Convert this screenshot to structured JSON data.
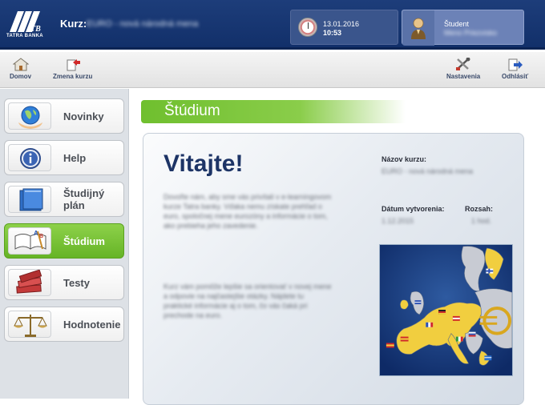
{
  "header": {
    "logo_text": "TATRA BANKA",
    "logo_initials": "TB",
    "course_label": "Kurz:",
    "course_name": "EURO - nová národná mena",
    "date": "13.01.2016",
    "time": "10:53",
    "user_role": "Študent",
    "user_name": "Meno Priezvisko"
  },
  "toolbar": {
    "home_label": "Domov",
    "change_course_label": "Zmena kurzu",
    "settings_label": "Nastavenia",
    "logout_label": "Odhlásiť"
  },
  "sidebar": {
    "items": [
      {
        "label": "Novinky",
        "icon": "globe-icon"
      },
      {
        "label": "Help",
        "icon": "info-icon"
      },
      {
        "label": "Študijný plán",
        "label_line1": "Študijný",
        "label_line2": "plán",
        "icon": "folder-icon"
      },
      {
        "label": "Štúdium",
        "icon": "book-icon",
        "active": true
      },
      {
        "label": "Testy",
        "icon": "books-icon"
      },
      {
        "label": "Hodnotenie",
        "icon": "scales-icon"
      }
    ]
  },
  "main": {
    "section_title": "Štúdium",
    "welcome": "Vitajte!",
    "paragraph1": "Dovoľte nám, aby sme vás privítali v e-learningovom kurze Tatra banky. Vďaka nemu získate prehľad o euro, spoločnej mene eurozóny a informácie o tom, ako prebieha jeho zavedenie.",
    "paragraph2": "Kurz vám pomôže lepšie sa orientovať v novej mene a odpovie na najčastejšie otázky. Nájdete tu praktické informácie aj o tom, čo vás čaká pri prechode na euro.",
    "course_name_label": "Názov kurzu:",
    "course_name_value": "EURO - nová národná mena",
    "created_label": "Dátum vytvorenia:",
    "created_value": "1.12.2015",
    "scope_label": "Rozsah:",
    "scope_value": "1 hod."
  },
  "colors": {
    "header": "#1d3d7a",
    "accent_green": "#6fbf2e",
    "title_blue": "#1d3466"
  }
}
